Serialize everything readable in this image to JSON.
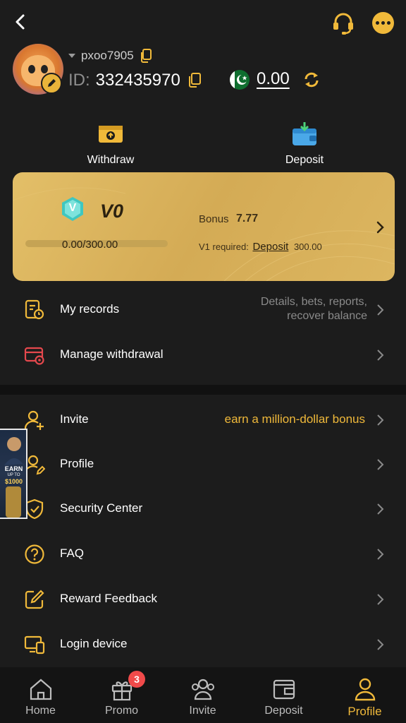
{
  "user": {
    "username": "pxoo7905",
    "id_label": "ID:",
    "id_value": "332435970",
    "balance": "0.00"
  },
  "actions": {
    "withdraw_label": "Withdraw",
    "deposit_label": "Deposit"
  },
  "vip": {
    "badge_letter": "V",
    "level": "V0",
    "progress_text": "0.00/300.00",
    "progress_value": 0,
    "bonus_label": "Bonus",
    "bonus_value": "7.77",
    "required_prefix": "V1 required:",
    "required_link": "Deposit",
    "required_amount": "300.00"
  },
  "menu_top": [
    {
      "label": "My records",
      "sub_line1": "Details, bets, reports,",
      "sub_line2": "recover balance"
    },
    {
      "label": "Manage withdrawal"
    }
  ],
  "menu_bottom": [
    {
      "label": "Invite",
      "sub": "earn a million-dollar bonus"
    },
    {
      "label": "Profile"
    },
    {
      "label": "Security Center"
    },
    {
      "label": "FAQ"
    },
    {
      "label": "Reward Feedback"
    },
    {
      "label": "Login device"
    }
  ],
  "promo_float": {
    "line1": "EARN",
    "line2": "UP TO",
    "line3": "$1000"
  },
  "tabs": [
    {
      "label": "Home"
    },
    {
      "label": "Promo",
      "badge": "3"
    },
    {
      "label": "Invite"
    },
    {
      "label": "Deposit"
    },
    {
      "label": "Profile"
    }
  ],
  "colors": {
    "accent": "#f0b93a",
    "background": "#1c1c1c",
    "card_gold": "#d9b35f",
    "badge_red": "#f04a4a"
  },
  "icons": {
    "back": "back-arrow-icon",
    "support": "headset-icon",
    "more": "more-dots-icon",
    "copy": "copy-icon",
    "refresh": "refresh-icon",
    "flag": "pakistan-flag-icon"
  }
}
